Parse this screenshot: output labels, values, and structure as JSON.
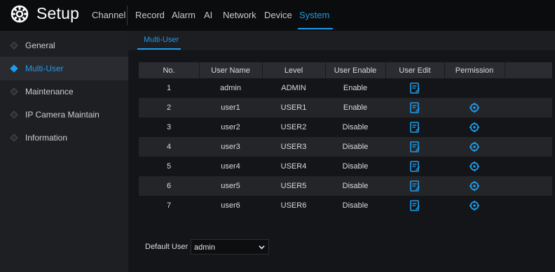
{
  "header": {
    "title": "Setup",
    "logo_icon": "gear-icon",
    "tabs": [
      {
        "label": "Channel"
      },
      {
        "label": "Record"
      },
      {
        "label": "Alarm"
      },
      {
        "label": "AI"
      },
      {
        "label": "Network"
      },
      {
        "label": "Device"
      },
      {
        "label": "System"
      }
    ],
    "active_tab": "System"
  },
  "sidebar": {
    "items": [
      {
        "label": "General"
      },
      {
        "label": "Multi-User"
      },
      {
        "label": "Maintenance"
      },
      {
        "label": "IP Camera Maintain"
      },
      {
        "label": "Information"
      }
    ],
    "active_item": "Multi-User"
  },
  "subtab": {
    "label": "Multi-User"
  },
  "table": {
    "columns": [
      "No.",
      "User Name",
      "Level",
      "User Enable",
      "User Edit",
      "Permission"
    ],
    "rows": [
      {
        "no": "1",
        "user": "admin",
        "level": "ADMIN",
        "enable": "Enable",
        "edit_icon": "edit-icon",
        "perm_icon": ""
      },
      {
        "no": "2",
        "user": "user1",
        "level": "USER1",
        "enable": "Enable",
        "edit_icon": "edit-icon",
        "perm_icon": "gear-icon"
      },
      {
        "no": "3",
        "user": "user2",
        "level": "USER2",
        "enable": "Disable",
        "edit_icon": "edit-icon",
        "perm_icon": "gear-icon"
      },
      {
        "no": "4",
        "user": "user3",
        "level": "USER3",
        "enable": "Disable",
        "edit_icon": "edit-icon",
        "perm_icon": "gear-icon"
      },
      {
        "no": "5",
        "user": "user4",
        "level": "USER4",
        "enable": "Disable",
        "edit_icon": "edit-icon",
        "perm_icon": "gear-icon"
      },
      {
        "no": "6",
        "user": "user5",
        "level": "USER5",
        "enable": "Disable",
        "edit_icon": "edit-icon",
        "perm_icon": "gear-icon"
      },
      {
        "no": "7",
        "user": "user6",
        "level": "USER6",
        "enable": "Disable",
        "edit_icon": "edit-icon",
        "perm_icon": "gear-icon"
      }
    ]
  },
  "default_user": {
    "label": "Default User",
    "value": "admin",
    "icon": "chevron-down-icon"
  },
  "colors": {
    "accent": "#1e9be9",
    "background": "#141518",
    "topbar": "#0b0c0e",
    "sidebar": "#1e1f23"
  }
}
